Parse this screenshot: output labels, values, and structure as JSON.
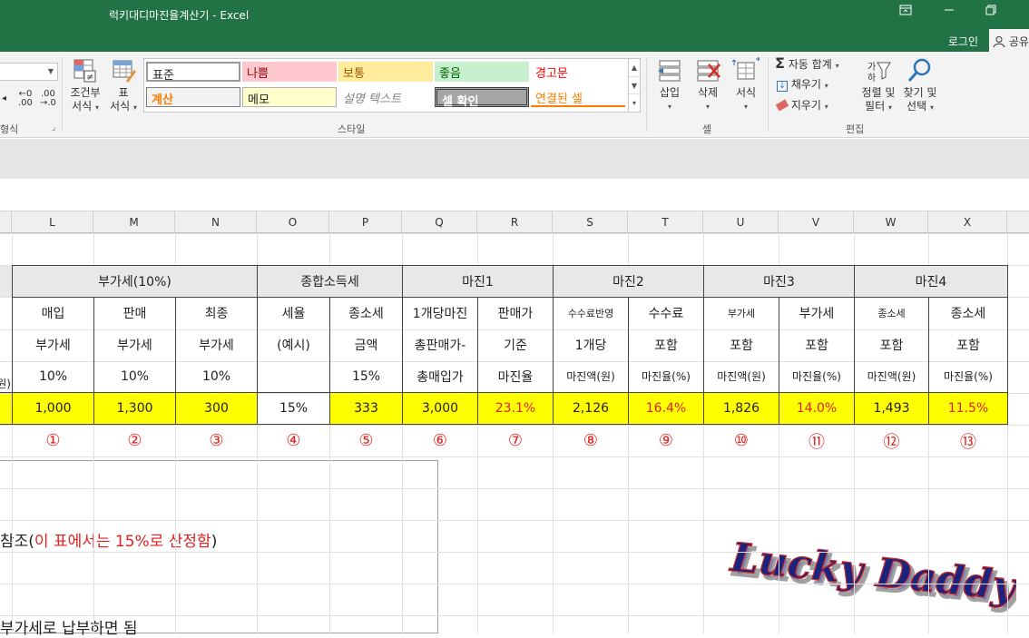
{
  "window": {
    "title": "럭키대디마진율계산기 - Excel",
    "login": "로그인",
    "share": "공유"
  },
  "ribbon": {
    "cond_format": [
      "조건부",
      "서식"
    ],
    "table_format": [
      "표",
      "서식"
    ],
    "number_group_label": "형식",
    "styles": {
      "label": "스타일",
      "cells": [
        {
          "text": "표준",
          "bg": "#ffffff",
          "color": "#222222"
        },
        {
          "text": "나쁨",
          "bg": "#ffc7ce",
          "color": "#9c0006"
        },
        {
          "text": "보통",
          "bg": "#ffeb9c",
          "color": "#9c5700"
        },
        {
          "text": "좋음",
          "bg": "#c6efce",
          "color": "#006100"
        },
        {
          "text": "경고문",
          "bg": "#ffffff",
          "color": "#ff0000"
        },
        {
          "text": "계산",
          "bg": "#f2f2f2",
          "color": "#fa7d00"
        },
        {
          "text": "메모",
          "bg": "#ffffcc",
          "color": "#222222"
        },
        {
          "text": "설명 텍스트",
          "bg": "#ffffff",
          "color": "#7f7f7f"
        },
        {
          "text": "셀 확인",
          "bg": "#a5a5a5",
          "color": "#ffffff"
        },
        {
          "text": "연결된 셀",
          "bg": "#ffffff",
          "color": "#fa7d00"
        }
      ]
    },
    "cells": {
      "label": "셀",
      "insert": "삽입",
      "delete": "삭제",
      "format": "서식"
    },
    "editing": {
      "label": "편집",
      "autosum": "자동 합계",
      "fill": "채우기",
      "clear": "지우기",
      "sort_filter": [
        "정렬 및",
        "필터"
      ],
      "find_select": [
        "찾기 및",
        "선택"
      ]
    }
  },
  "columns": [
    "L",
    "M",
    "N",
    "O",
    "P",
    "Q",
    "R",
    "S",
    "T",
    "U",
    "V",
    "W",
    "X"
  ],
  "table": {
    "groups": [
      {
        "label": "부가세(10%)"
      },
      {
        "label": "종합소득세"
      },
      {
        "label": "마진1"
      },
      {
        "label": "마진2"
      },
      {
        "label": "마진3"
      },
      {
        "label": "마진4"
      }
    ],
    "sub1": [
      "매입",
      "판매",
      "최종",
      "세율",
      "종소세",
      "1개당마진",
      "판매가",
      "수수료반영",
      "수수료",
      "부가세",
      "부가세",
      "종소세",
      "종소세"
    ],
    "sub2": [
      "부가세",
      "부가세",
      "부가세",
      "(예시)",
      "금액",
      "총판매가-",
      "기준",
      "1개당",
      "포함",
      "포함",
      "포함",
      "포함",
      "포함"
    ],
    "sub3": [
      "10%",
      "10%",
      "10%",
      "",
      "15%",
      "총매입가",
      "마진율",
      "마진액(원)",
      "마진율(%)",
      "마진액(원)",
      "마진율(%)",
      "마진액(원)",
      "마진율(%)"
    ],
    "left_partial": "원)",
    "values": [
      "1,000",
      "1,300",
      "300",
      "15%",
      "333",
      "3,000",
      "23.1%",
      "2,126",
      "16.4%",
      "1,826",
      "14.0%",
      "1,493",
      "11.5%"
    ],
    "markers": [
      "①",
      "②",
      "③",
      "④",
      "⑤",
      "⑥",
      "⑦",
      "⑧",
      "⑨",
      "⑩",
      "⑪",
      "⑫",
      "⑬"
    ]
  },
  "textbox": {
    "line1_prefix": "참조(",
    "line1_red": "이 표에서는 15%로 산정함",
    "line1_suffix": ")",
    "line2": "부가세로 납부하면 됨"
  },
  "logo_text": "Lucky Daddy"
}
